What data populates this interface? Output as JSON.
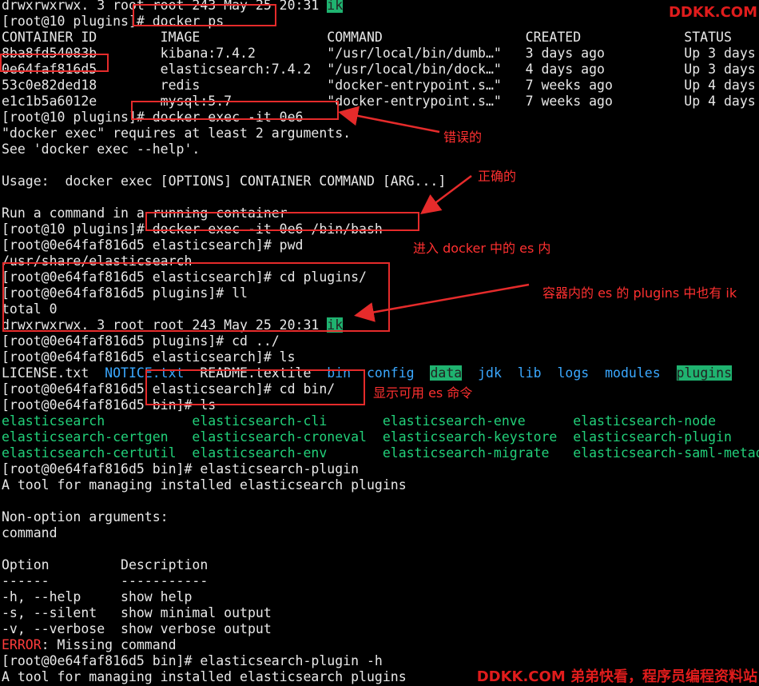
{
  "terminal": {
    "lines": [
      {
        "segs": [
          {
            "t": "drwxrwxrwx. 3 root root 243 May 25 20:31 "
          },
          {
            "t": "ik",
            "c": "hl"
          }
        ]
      },
      {
        "segs": [
          {
            "t": "[root@10 plugins]# docker ps"
          }
        ]
      },
      {
        "segs": [
          {
            "t": "CONTAINER ID        IMAGE                COMMAND                  CREATED             STATUS"
          }
        ]
      },
      {
        "segs": [
          {
            "t": "8ba8fd54083b        kibana:7.4.2         \"/usr/local/bin/dumb…\"   3 days ago          Up 3 days"
          }
        ]
      },
      {
        "segs": [
          {
            "t": "0e64faf816d5        elasticsearch:7.4.2  \"/usr/local/bin/dock…\"   4 days ago          Up 3 days"
          }
        ]
      },
      {
        "segs": [
          {
            "t": "53c0e82ded18        redis                \"docker-entrypoint.s…\"   7 weeks ago         Up 4 days"
          }
        ]
      },
      {
        "segs": [
          {
            "t": "e1c1b5a6012e        mysql:5.7            \"docker-entrypoint.s…\"   7 weeks ago         Up 4 days"
          }
        ]
      },
      {
        "segs": [
          {
            "t": "[root@10 plugins]# docker exec -it 0e6"
          }
        ]
      },
      {
        "segs": [
          {
            "t": "\"docker exec\" requires at least 2 arguments."
          }
        ]
      },
      {
        "segs": [
          {
            "t": "See 'docker exec --help'."
          }
        ]
      },
      {
        "segs": [
          {
            "t": ""
          }
        ]
      },
      {
        "segs": [
          {
            "t": "Usage:  docker exec [OPTIONS] CONTAINER COMMAND [ARG...]"
          }
        ]
      },
      {
        "segs": [
          {
            "t": ""
          }
        ]
      },
      {
        "segs": [
          {
            "t": "Run a command in a running container"
          }
        ]
      },
      {
        "segs": [
          {
            "t": "[root@10 plugins]# docker exec -it 0e6 /bin/bash"
          }
        ]
      },
      {
        "segs": [
          {
            "t": "[root@0e64faf816d5 elasticsearch]# pwd"
          }
        ]
      },
      {
        "segs": [
          {
            "t": "/usr/share/elasticsearch"
          }
        ]
      },
      {
        "segs": [
          {
            "t": "[root@0e64faf816d5 elasticsearch]# cd plugins/"
          }
        ]
      },
      {
        "segs": [
          {
            "t": "[root@0e64faf816d5 plugins]# ll"
          }
        ]
      },
      {
        "segs": [
          {
            "t": "total 0"
          }
        ]
      },
      {
        "segs": [
          {
            "t": "drwxrwxrwx. 3 root root 243 May 25 20:31 "
          },
          {
            "t": "ik",
            "c": "hl"
          }
        ]
      },
      {
        "segs": [
          {
            "t": "[root@0e64faf816d5 plugins]# cd ../"
          }
        ]
      },
      {
        "segs": [
          {
            "t": "[root@0e64faf816d5 elasticsearch]# ls"
          }
        ]
      },
      {
        "segs": [
          {
            "t": "LICENSE.txt  "
          },
          {
            "t": "NOTICE.txt",
            "c": "blue"
          },
          {
            "t": "  README.textile  "
          },
          {
            "t": "bin",
            "c": "blue"
          },
          {
            "t": "  "
          },
          {
            "t": "config",
            "c": "blue"
          },
          {
            "t": "  "
          },
          {
            "t": "data",
            "c": "hl"
          },
          {
            "t": "  "
          },
          {
            "t": "jdk",
            "c": "blue"
          },
          {
            "t": "  "
          },
          {
            "t": "lib",
            "c": "blue"
          },
          {
            "t": "  "
          },
          {
            "t": "logs",
            "c": "blue"
          },
          {
            "t": "  "
          },
          {
            "t": "modules",
            "c": "blue"
          },
          {
            "t": "  "
          },
          {
            "t": "plugins",
            "c": "hl"
          }
        ]
      },
      {
        "segs": [
          {
            "t": "[root@0e64faf816d5 elasticsearch]# cd bin/"
          }
        ]
      },
      {
        "segs": [
          {
            "t": "[root@0e64faf816d5 bin]# ls"
          }
        ]
      },
      {
        "segs": [
          {
            "t": "elasticsearch           elasticsearch-cli       elasticsearch-enve      elasticsearch-node",
            "c": "green"
          }
        ]
      },
      {
        "segs": [
          {
            "t": "elasticsearch-certgen   elasticsearch-croneval  elasticsearch-keystore  elasticsearch-plugin",
            "c": "green"
          }
        ]
      },
      {
        "segs": [
          {
            "t": "elasticsearch-certutil  elasticsearch-env       elasticsearch-migrate   elasticsearch-saml-metadata",
            "c": "green"
          }
        ]
      },
      {
        "segs": [
          {
            "t": "[root@0e64faf816d5 bin]# elasticsearch-plugin"
          }
        ]
      },
      {
        "segs": [
          {
            "t": "A tool for managing installed elasticsearch plugins"
          }
        ]
      },
      {
        "segs": [
          {
            "t": ""
          }
        ]
      },
      {
        "segs": [
          {
            "t": "Non-option arguments:"
          }
        ]
      },
      {
        "segs": [
          {
            "t": "command"
          }
        ]
      },
      {
        "segs": [
          {
            "t": ""
          }
        ]
      },
      {
        "segs": [
          {
            "t": "Option         Description"
          }
        ]
      },
      {
        "segs": [
          {
            "t": "------         -----------"
          }
        ]
      },
      {
        "segs": [
          {
            "t": "-h, --help     show help"
          }
        ]
      },
      {
        "segs": [
          {
            "t": "-s, --silent   show minimal output"
          }
        ]
      },
      {
        "segs": [
          {
            "t": "-v, --verbose  show verbose output"
          }
        ]
      },
      {
        "segs": [
          {
            "t": "ERROR",
            "c": "err"
          },
          {
            "t": ": Missing command"
          }
        ]
      },
      {
        "segs": [
          {
            "t": "[root@0e64faf816d5 bin]# elasticsearch-plugin -h"
          }
        ]
      },
      {
        "segs": [
          {
            "t": "A tool for managing installed elasticsearch plugins"
          }
        ]
      }
    ]
  },
  "annotations": {
    "wrong": "错误的",
    "correct": "正确的",
    "enter_es": "进入 docker 中的 es 内",
    "plugins_ik": "容器内的 es 的 plugins 中也有 ik",
    "show_cmds": "显示可用 es 命令"
  },
  "watermark": {
    "top": "DDKK.COM",
    "bottom": "DDKK.COM 弟弟快看，程序员编程资料站"
  },
  "colors": {
    "background": "#000000",
    "text": "#e8e8e8",
    "directory": "#3aa8ff",
    "executable": "#22d07a",
    "highlight": "#1fb370",
    "annotation": "#ff3030"
  }
}
